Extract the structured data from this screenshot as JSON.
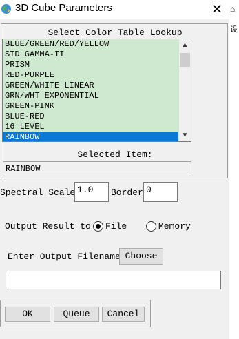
{
  "window": {
    "title": "3D Cube Parameters",
    "close_glyph": "✕",
    "app_icon": "globe-icon",
    "edge_glyph": "⌂",
    "edge_char": "设"
  },
  "color_table": {
    "label": "Select Color Table Lookup",
    "items": [
      "BLUE/GREEN/RED/YELLOW",
      "STD GAMMA-II",
      "PRISM",
      "RED-PURPLE",
      "GREEN/WHITE LINEAR",
      "GRN/WHT EXPONENTIAL",
      "GREEN-PINK",
      "BLUE-RED",
      "16 LEVEL",
      "RAINBOW"
    ],
    "selected_index": 9,
    "scroll_up_glyph": "▲",
    "scroll_down_glyph": "▼",
    "selected_label": "Selected Item:",
    "selected_value": "RAINBOW",
    "list_bg": "#cfe8d0",
    "selection_color": "#0a78d7"
  },
  "spectral": {
    "scale_label": "Spectral Scale",
    "scale_value": "1.0",
    "border_label": "Border",
    "border_value": "0"
  },
  "output": {
    "label": "Output Result to",
    "file_label": "File",
    "memory_label": "Memory",
    "selected": "File"
  },
  "filename": {
    "label": "Enter Output Filename",
    "choose_label": "Choose",
    "value": ""
  },
  "buttons": {
    "ok": "OK",
    "queue": "Queue",
    "cancel": "Cancel"
  }
}
